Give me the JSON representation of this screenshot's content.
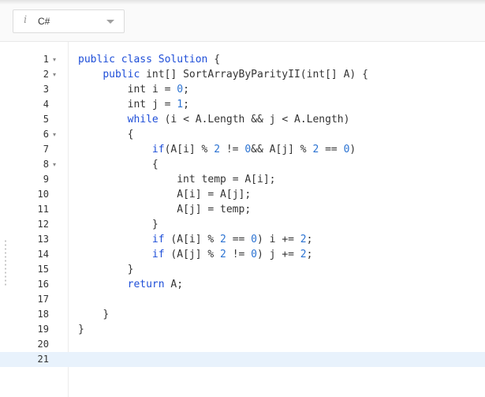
{
  "header": {
    "language": "C#",
    "info_glyph": "i",
    "icons": {
      "info": "info-icon",
      "dropdown": "chevron-down-icon",
      "fold": "fold-arrow-icon"
    }
  },
  "editor": {
    "active_line": 21,
    "lines": [
      {
        "n": "1",
        "fold": true,
        "code": "public class Solution {"
      },
      {
        "n": "2",
        "fold": true,
        "code": "    public int[] SortArrayByParityII(int[] A) {"
      },
      {
        "n": "3",
        "fold": false,
        "code": "        int i = 0;"
      },
      {
        "n": "4",
        "fold": false,
        "code": "        int j = 1;"
      },
      {
        "n": "5",
        "fold": false,
        "code": "        while (i < A.Length && j < A.Length)"
      },
      {
        "n": "6",
        "fold": true,
        "code": "        {"
      },
      {
        "n": "7",
        "fold": false,
        "code": "            if(A[i] % 2 != 0&& A[j] % 2 == 0)"
      },
      {
        "n": "8",
        "fold": true,
        "code": "            {"
      },
      {
        "n": "9",
        "fold": false,
        "code": "                int temp = A[i];"
      },
      {
        "n": "10",
        "fold": false,
        "code": "                A[i] = A[j];"
      },
      {
        "n": "11",
        "fold": false,
        "code": "                A[j] = temp;"
      },
      {
        "n": "12",
        "fold": false,
        "code": "            }"
      },
      {
        "n": "13",
        "fold": false,
        "code": "            if (A[i] % 2 == 0) i += 2;"
      },
      {
        "n": "14",
        "fold": false,
        "code": "            if (A[j] % 2 != 0) j += 2;"
      },
      {
        "n": "15",
        "fold": false,
        "code": "        }"
      },
      {
        "n": "16",
        "fold": false,
        "code": "        return A;"
      },
      {
        "n": "17",
        "fold": false,
        "code": ""
      },
      {
        "n": "18",
        "fold": false,
        "code": "    }"
      },
      {
        "n": "19",
        "fold": false,
        "code": "}"
      },
      {
        "n": "20",
        "fold": false,
        "code": ""
      },
      {
        "n": "21",
        "fold": false,
        "code": ""
      }
    ]
  }
}
